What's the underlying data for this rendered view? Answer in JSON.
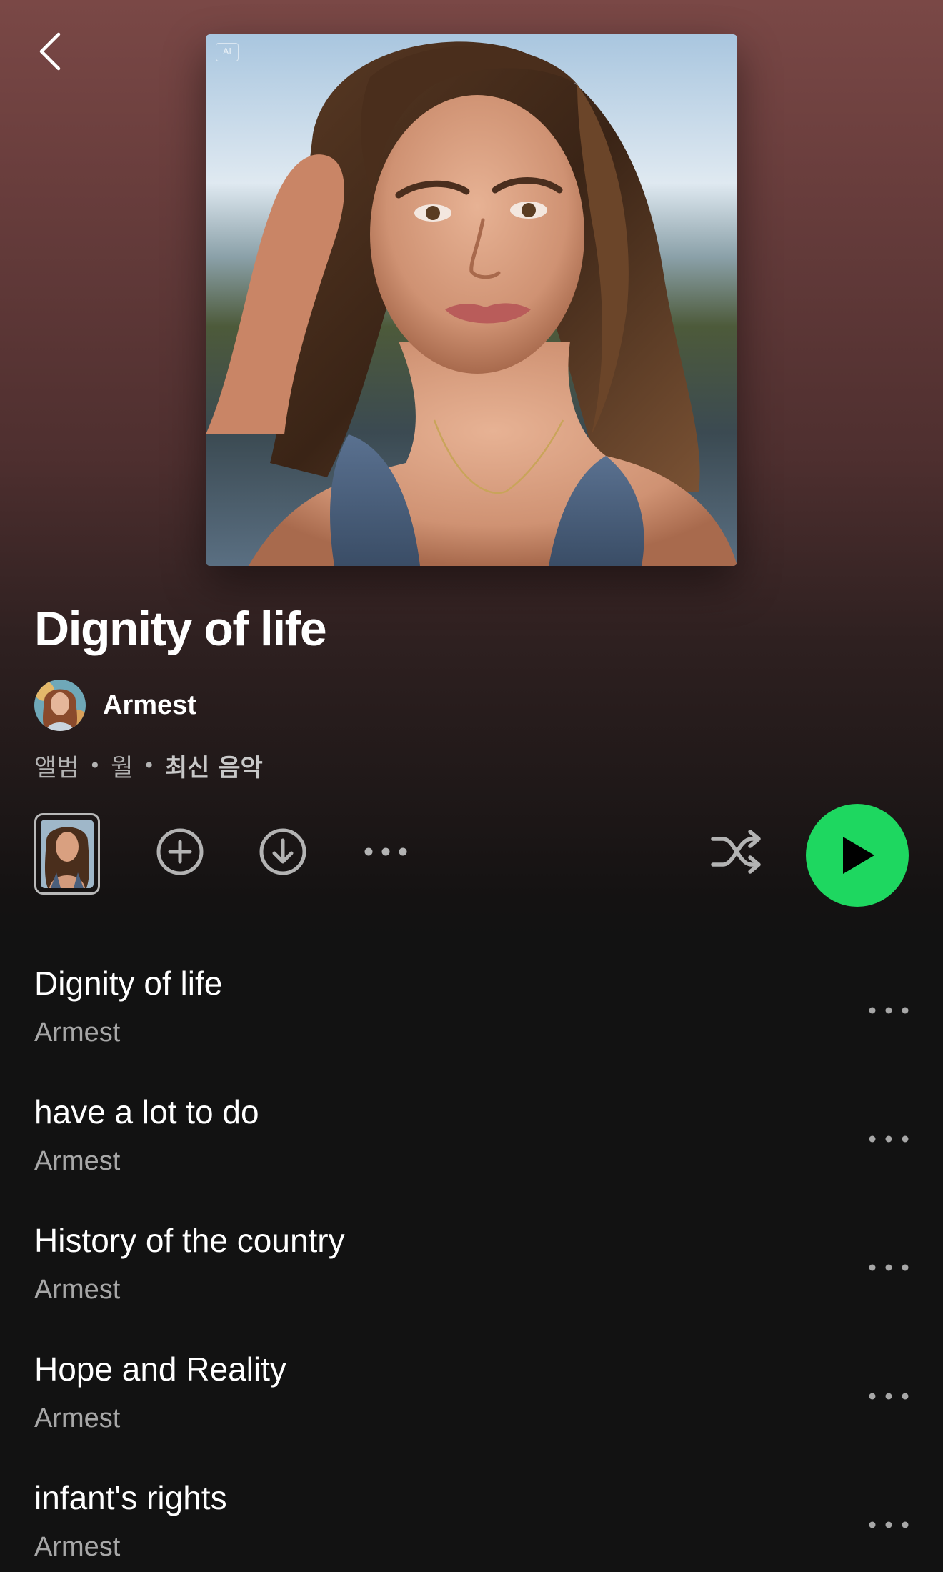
{
  "header": {
    "back_icon": "chevron-left-icon",
    "ai_badge": "AI"
  },
  "album": {
    "title": "Dignity of life",
    "artist": "Armest",
    "meta": {
      "type": "앨범",
      "period": "월",
      "badge": "최신 음악"
    }
  },
  "actions": {
    "add_icon": "plus-circle-icon",
    "download_icon": "download-circle-icon",
    "more_icon": "more-horizontal-icon",
    "shuffle_icon": "shuffle-icon",
    "play_icon": "play-icon"
  },
  "tracks": [
    {
      "title": "Dignity of life",
      "artist": "Armest"
    },
    {
      "title": "have a lot to do",
      "artist": "Armest"
    },
    {
      "title": "History of the country",
      "artist": "Armest"
    },
    {
      "title": "Hope and Reality",
      "artist": "Armest"
    },
    {
      "title": "infant's rights",
      "artist": "Armest"
    }
  ],
  "colors": {
    "accent": "#1ed760",
    "background": "#121212",
    "header_gradient_top": "#7a4846",
    "text_secondary": "#a7a7a7"
  }
}
